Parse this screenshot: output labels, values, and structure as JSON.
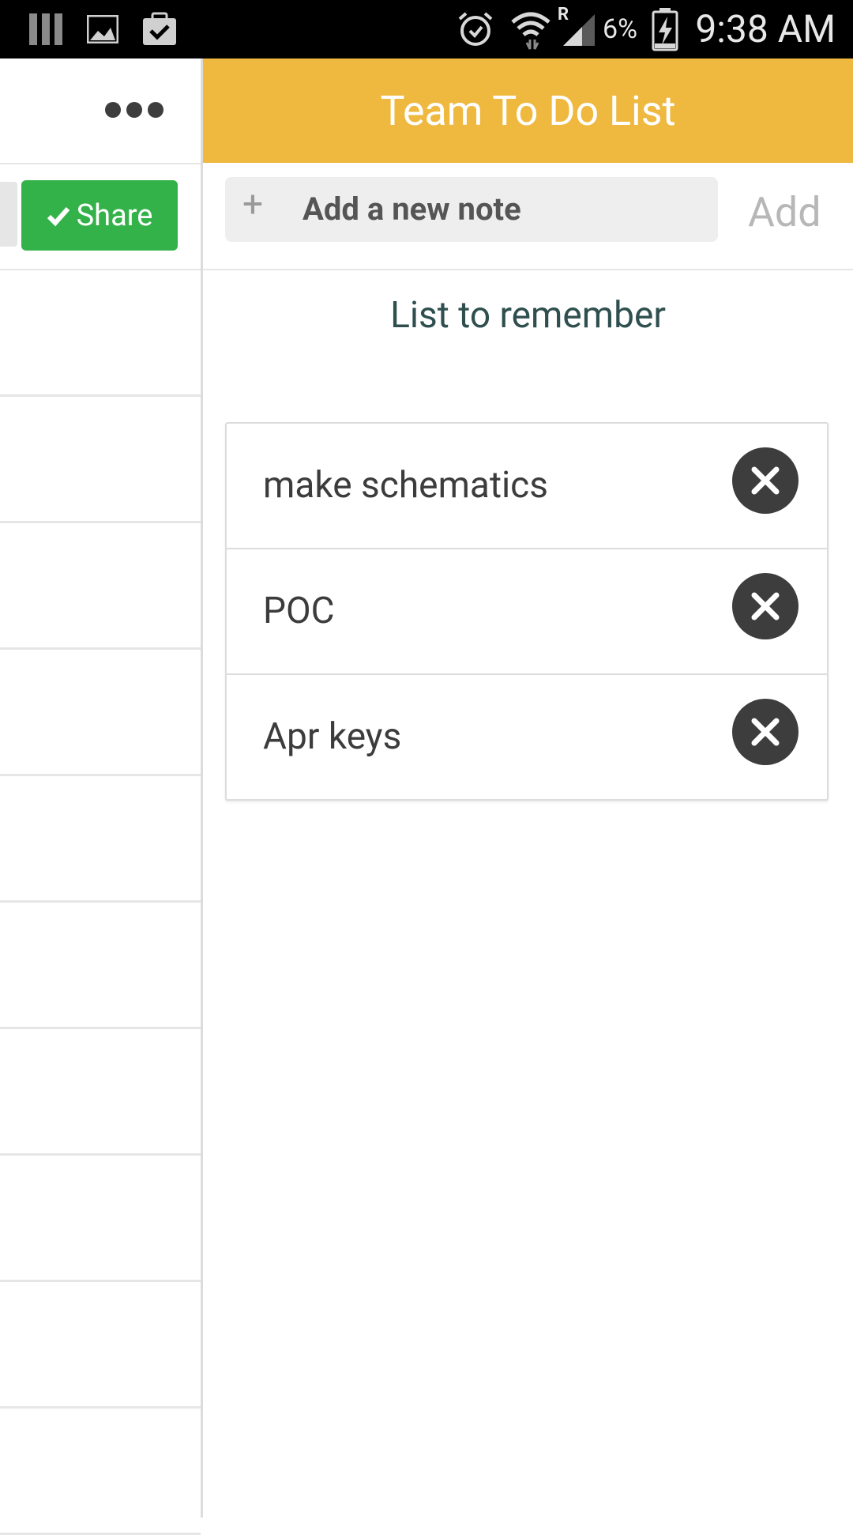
{
  "status_bar": {
    "time": "9:38 AM",
    "battery_percent": "6%",
    "roaming": "R",
    "icons": [
      "sim-bars-icon",
      "image-icon",
      "clipboard-check-icon",
      "alarm-icon",
      "wifi-icon",
      "signal-icon",
      "battery-charging-icon"
    ]
  },
  "left_panel": {
    "more_icon": "ellipsis-icon",
    "share_label": "Share",
    "share_icon": "check-icon",
    "share_color": "#34b24a"
  },
  "right_panel": {
    "title": "Team To Do List",
    "header_color": "#efb83f",
    "add_note": {
      "plus": "+",
      "placeholder": "Add a new note",
      "button_label": "Add"
    },
    "section_title": "List to remember",
    "items": [
      {
        "label": "make schematics"
      },
      {
        "label": "POC"
      },
      {
        "label": "Apr keys"
      }
    ]
  }
}
